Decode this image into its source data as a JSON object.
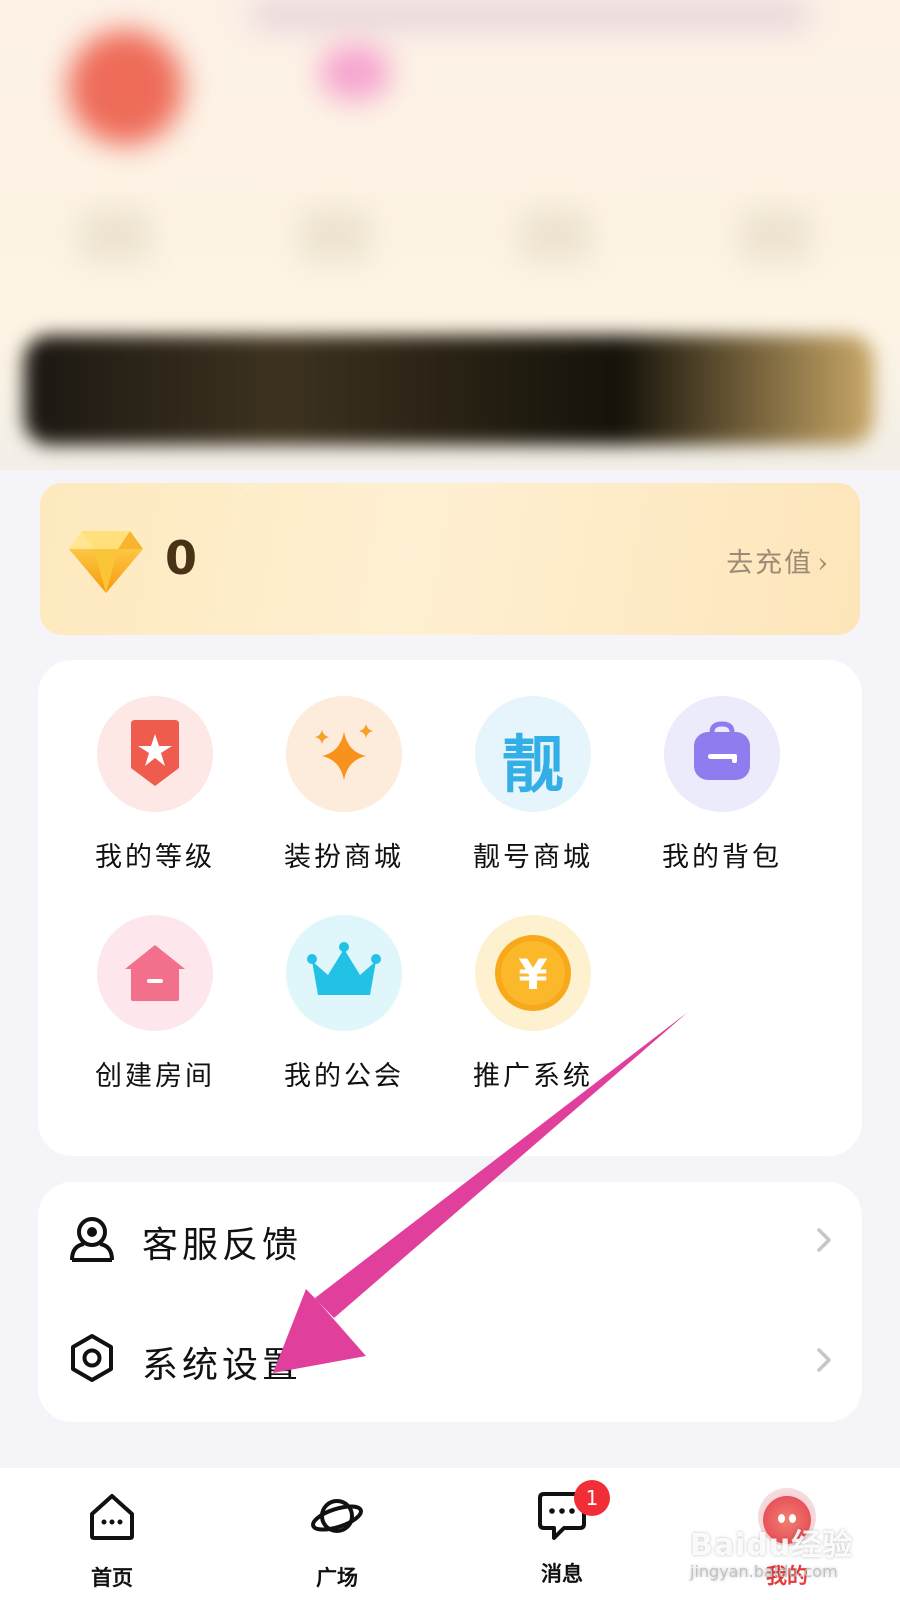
{
  "wallet": {
    "balance": "0",
    "recharge_label": "去充值",
    "chevron": "›"
  },
  "features": [
    {
      "label": "我的等级",
      "icon": "level-badge-icon",
      "color": "#ef5b4c"
    },
    {
      "label": "装扮商城",
      "icon": "sparkle-icon",
      "color": "#f7921d"
    },
    {
      "label": "靓号商城",
      "icon": "liang-icon",
      "glyph": "靓",
      "color": "#33aee6"
    },
    {
      "label": "我的背包",
      "icon": "backpack-icon",
      "color": "#8f7df0"
    },
    {
      "label": "创建房间",
      "icon": "house-icon",
      "color": "#f2708c"
    },
    {
      "label": "我的公会",
      "icon": "crown-icon",
      "color": "#22c1e6"
    },
    {
      "label": "推广系统",
      "icon": "yuan-coin-icon",
      "glyph": "¥",
      "color": "#f8a91b"
    }
  ],
  "menu": [
    {
      "label": "客服反馈",
      "icon": "customer-service-icon"
    },
    {
      "label": "系统设置",
      "icon": "settings-hexagon-icon"
    }
  ],
  "nav": [
    {
      "label": "首页",
      "icon": "home-icon"
    },
    {
      "label": "广场",
      "icon": "planet-icon"
    },
    {
      "label": "消息",
      "icon": "message-icon",
      "badge": "1"
    },
    {
      "label": "我的",
      "icon": "my-avatar-icon",
      "active": true
    }
  ],
  "watermark": {
    "brand": "Baidu经验",
    "url": "jingyan.baidu.com"
  },
  "colors": {
    "accent": "#e83b3b",
    "annotation_arrow": "#e0409c"
  }
}
